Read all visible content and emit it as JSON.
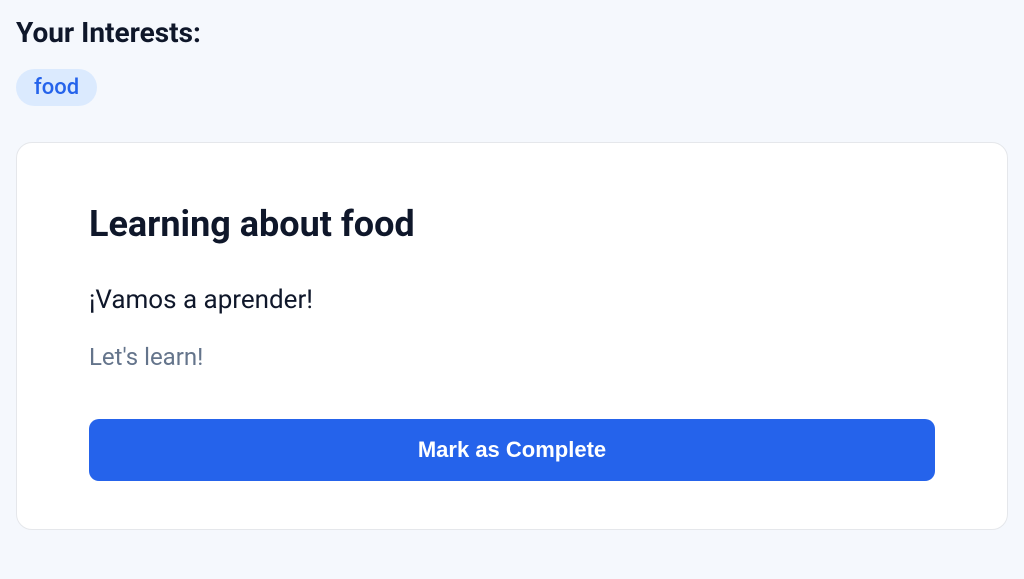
{
  "interests": {
    "title": "Your Interests:",
    "tags": [
      "food"
    ]
  },
  "lesson": {
    "title": "Learning about food",
    "primary_text": "¡Vamos a aprender!",
    "secondary_text": "Let's learn!",
    "complete_button_label": "Mark as Complete"
  }
}
